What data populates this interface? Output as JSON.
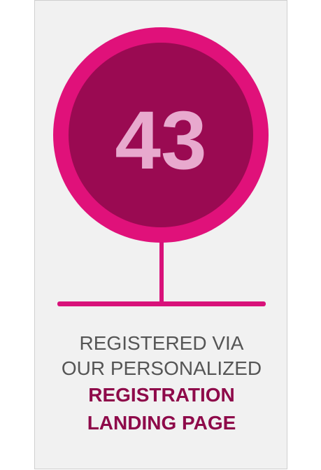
{
  "stat": {
    "value": "43",
    "colors": {
      "outer_ring": "#e0117a",
      "inner_circle": "#9a0a52",
      "number": "#e8a9ce",
      "stem": "#d8127a"
    }
  },
  "caption": {
    "line1": "REGISTERED VIA",
    "line2": "OUR PERSONALIZED",
    "highlight1": "REGISTRATION",
    "highlight2": "LANDING PAGE"
  }
}
